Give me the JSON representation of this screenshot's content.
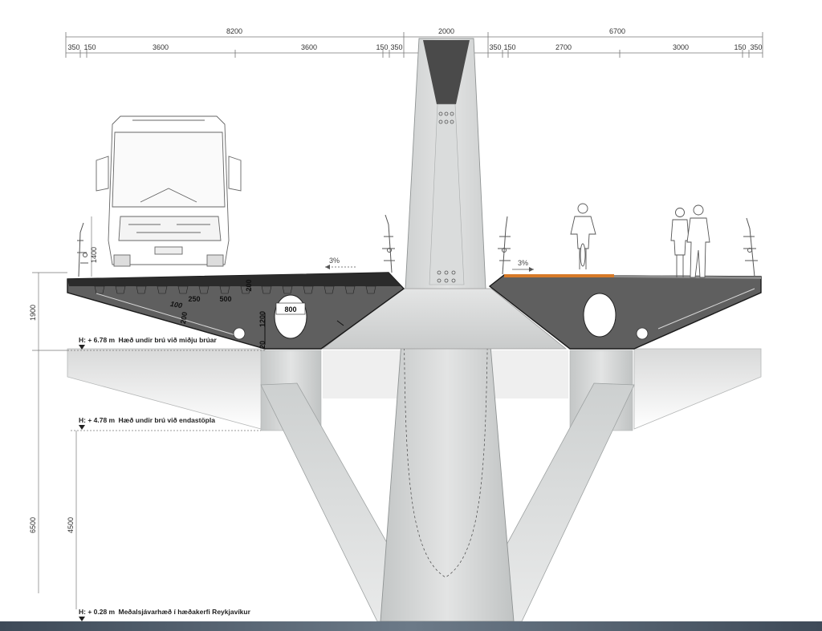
{
  "dimensions": {
    "top": {
      "left_total": "8200",
      "center_total": "2000",
      "right_total": "6700"
    },
    "left_segments": [
      "350",
      "150",
      "3600",
      "3600",
      "150",
      "350"
    ],
    "right_segments": [
      "350",
      "150",
      "2700",
      "3000",
      "150",
      "350"
    ],
    "vertical": {
      "deck_depth": "1900",
      "total_height": "6500",
      "clearance": "4500",
      "railing_height": "1400"
    }
  },
  "section_labels": {
    "void_width": "800",
    "box_height": "1200",
    "rib_spacing_a": "250",
    "rib_spacing_b": "500",
    "rib_depth": "200",
    "wall_a": "100",
    "wall_b": "200",
    "bottom_slab": "20"
  },
  "slopes": {
    "left": "3%",
    "right": "3%"
  },
  "levels": [
    {
      "value": "H: + 6.78 m",
      "text": "Hæð undir brú við miðju brúar"
    },
    {
      "value": "H: + 4.78 m",
      "text": "Hæð undir brú við endastöpla"
    },
    {
      "value": "H: + 0.28 m",
      "text": "Meðalsjávarhæð í hæðakerfi Reykjavíkur"
    }
  ],
  "colors": {
    "deck_fill": "#5f5f5f",
    "deck_stroke": "#1a1a1a",
    "pylon_face": "#cfd2d2",
    "pylon_dark": "#4a4a4a",
    "bikepath": "#d77a28",
    "water": "#5a6878"
  }
}
